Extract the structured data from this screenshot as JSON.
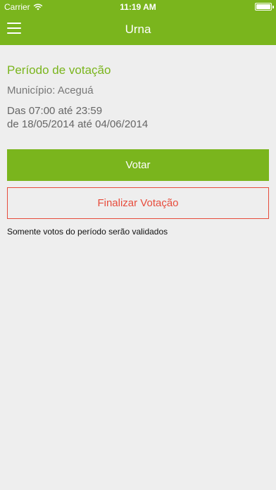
{
  "status_bar": {
    "carrier": "Carrier",
    "time": "11:19 AM",
    "wifi_icon": "wifi-icon",
    "battery_icon": "battery-icon"
  },
  "nav": {
    "title": "Urna",
    "menu_icon": "hamburger-menu-icon"
  },
  "main": {
    "section_title": "Período de votação",
    "municipio": "Município: Aceguá",
    "periodo_hours": "Das 07:00 até 23:59",
    "periodo_dates": "de 18/05/2014 até 04/06/2014",
    "vote_label": "Votar",
    "finish_label": "Finalizar Votação",
    "note": "Somente votos do período serão validados"
  },
  "colors": {
    "brand_green": "#7ab51d",
    "danger_red": "#e74c3c",
    "background": "#eeeeee"
  }
}
